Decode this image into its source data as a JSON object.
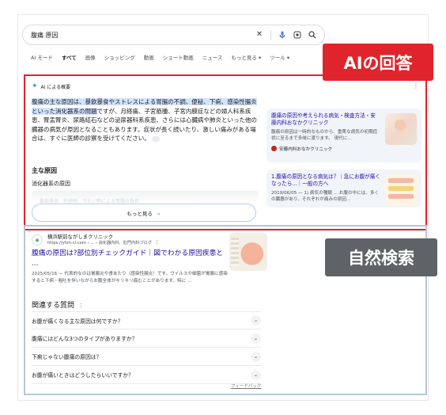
{
  "search": {
    "query": "腹痛 原因",
    "icons": [
      "close-icon",
      "mic-icon",
      "lens-icon",
      "search-icon"
    ]
  },
  "tabs": [
    "AI モード",
    "すべて",
    "画像",
    "ショッピング",
    "動画",
    "ショート動画",
    "ニュース",
    "もっと見る ▾",
    "ツール ▾"
  ],
  "ai_overview": {
    "header": "AI による概要",
    "text_highlight": "腹痛の主な原因は、暴飲暴食やストレスによる胃腸の不調、便秘、下痢、感染性腸炎といった消化器系の問題",
    "text_rest": "ですが、月経痛、子宮筋腫、子宮内膜症などの婦人科系疾患、腎盂腎炎、尿路結石などの泌尿器科系疾患、さらには心臓病や肺炎といった他の臓器の病気が原因となることもあります。症状が長く続いたり、激しい痛みがある場合は、すぐに医師の診察を受けてください。",
    "subheading": "主な原因",
    "subitem": "消化器系の原因",
    "faded": "暴飲暴食、刺激物、冷たい物による胃腸の負担",
    "more_label": "もっと見る",
    "cards": [
      {
        "title": "腹痛の原因や考えられる病気・検査方法・安藤内科おなかクリニック",
        "snippet": "腹痛の原因は一時的なものから、重篤な病気の初期症状に至るまで多岐に渡ります。 現代に...",
        "source": "安藤内科おなかクリニック"
      },
      {
        "title": "1.腹痛の原因となる病気は？｜急にお腹が痛くなったら...｜一般の方へ",
        "snippet": "2019/06/05 — 1) 病気の種類 ... お腹の中には、多くの臓器があり、それぞれが痛みの原因..."
      }
    ]
  },
  "badges": {
    "ai": "AIの回答",
    "organic": "自然検索"
  },
  "result": {
    "site_name": "横浜駅前ながしまクリニック",
    "url": "https://yhm-cl.com › ... › 消化器内科、肛門内科ブログ",
    "title": "腹痛の原因は?部位別チェックガイド｜図でわかる原因疾患と ...",
    "snippet": "2025/05/16 — 代表的なのは胃腸炎や食あたり（感染性腸炎）です。ウイルスや細菌が胃腸に感染すると下痢・嘔吐を伴いながらお腹全体がキリキリ痛むことがあります。特に ..."
  },
  "paa": {
    "title": "関連する質問",
    "items": [
      "お腹が痛くなる主な原因は何ですか？",
      "腹痛にはどんな3つのタイプがありますか？",
      "下痢じゃない腹痛の原因は？",
      "お腹が痛いときはどうしたらいいですか？"
    ],
    "feedback": "フィードバック"
  },
  "colors": {
    "ai_border": "#e0242b",
    "organic_border": "#b8c5d6",
    "badge_ai": "#e0242b",
    "badge_organic": "#5f6368",
    "link": "#1a0dab"
  }
}
